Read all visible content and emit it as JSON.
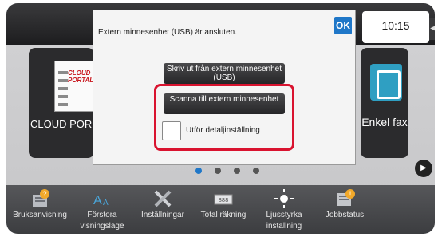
{
  "status": {
    "time": "10:15"
  },
  "tiles": {
    "cloud": {
      "label": "CLOUD POR",
      "logo_text": "CLOUD PORTAL"
    },
    "fax": {
      "label": "Enkel fax"
    }
  },
  "dialog": {
    "message": "Extern minnesenhet (USB) är ansluten.",
    "ok_label": "OK",
    "print_button": "Skriv ut från extern minnesenhet (USB)",
    "scan_button": "Scanna till extern minnesenhet",
    "detail_checkbox_label": "Utför detaljinställning",
    "detail_checked": false
  },
  "pager": {
    "count": 4,
    "active_index": 0
  },
  "bottombar": {
    "items": [
      {
        "label": "Bruksanvisning",
        "icon": "manual-icon"
      },
      {
        "label": "Förstora visningsläge",
        "icon": "enlarge-display-icon"
      },
      {
        "label": "Inställningar",
        "icon": "settings-tools-icon"
      },
      {
        "label": "Total räkning",
        "icon": "counter-icon"
      },
      {
        "label": "Ljusstyrka inställning",
        "icon": "brightness-icon"
      },
      {
        "label": "Jobbstatus",
        "icon": "job-status-icon"
      }
    ]
  },
  "colors": {
    "accent": "#1f77c8",
    "highlight": "#d9132f"
  }
}
